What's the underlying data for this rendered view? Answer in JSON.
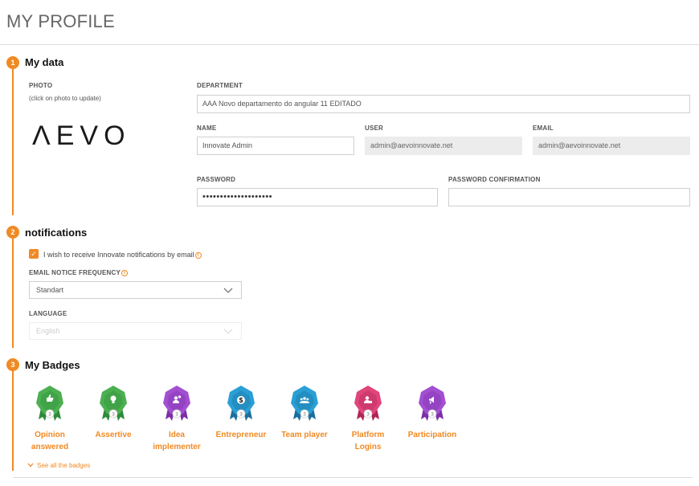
{
  "page_title": "MY PROFILE",
  "sections": {
    "my_data": {
      "number": "1",
      "title": "My data"
    },
    "notifications": {
      "number": "2",
      "title": "notifications"
    },
    "badges": {
      "number": "3",
      "title": "My Badges"
    }
  },
  "photo": {
    "label": "PHOTO",
    "hint": "(click on photo to update)",
    "logo_text": "ΛEVO"
  },
  "fields": {
    "department": {
      "label": "DEPARTMENT",
      "value": "AAA Novo departamento do angular 11 EDITADO"
    },
    "name": {
      "label": "NAME",
      "value": "Innovate Admin"
    },
    "user": {
      "label": "USER",
      "value": "admin@aevoinnovate.net"
    },
    "email": {
      "label": "EMAIL",
      "value": "admin@aevoinnovate.net"
    },
    "password": {
      "label": "PASSWORD",
      "value": "••••••••••••••••••••"
    },
    "password_confirmation": {
      "label": "PASSWORD CONFIRMATION",
      "value": ""
    }
  },
  "notifications": {
    "checkbox_label": "I wish to receive Innovate notifications by email",
    "checked": true,
    "frequency_label": "EMAIL NOTICE FREQUENCY",
    "frequency_value": "Standart",
    "language_label": "LANGUAGE",
    "language_value": "English"
  },
  "badges": [
    {
      "label_line1": "Opinion",
      "label_line2": "answered",
      "level": "3",
      "color": "#4caf50",
      "dark": "#2e8b3a",
      "icon": "thumb-icon"
    },
    {
      "label_line1": "Assertive",
      "label_line2": "",
      "level": "3",
      "color": "#4caf50",
      "dark": "#2e8b3a",
      "icon": "bulb-icon"
    },
    {
      "label_line1": "Idea",
      "label_line2": "implementer",
      "level": "3",
      "color": "#a24fd1",
      "dark": "#7b2fa8",
      "icon": "person-gear-icon"
    },
    {
      "label_line1": "Entrepreneur",
      "label_line2": "",
      "level": "3",
      "color": "#2a9fd6",
      "dark": "#1a6f9c",
      "icon": "coin-icon"
    },
    {
      "label_line1": "Team player",
      "label_line2": "",
      "level": "3",
      "color": "#2a9fd6",
      "dark": "#1a6f9c",
      "icon": "team-icon"
    },
    {
      "label_line1": "Platform",
      "label_line2": "Logins",
      "level": "3",
      "color": "#e0457b",
      "dark": "#b02457",
      "icon": "person-login-icon"
    },
    {
      "label_line1": "Participation",
      "label_line2": "",
      "level": "3",
      "color": "#a24fd1",
      "dark": "#7b2fa8",
      "icon": "megaphone-icon"
    }
  ],
  "see_all_label": "See all the badges",
  "colors": {
    "accent": "#f08a24"
  }
}
